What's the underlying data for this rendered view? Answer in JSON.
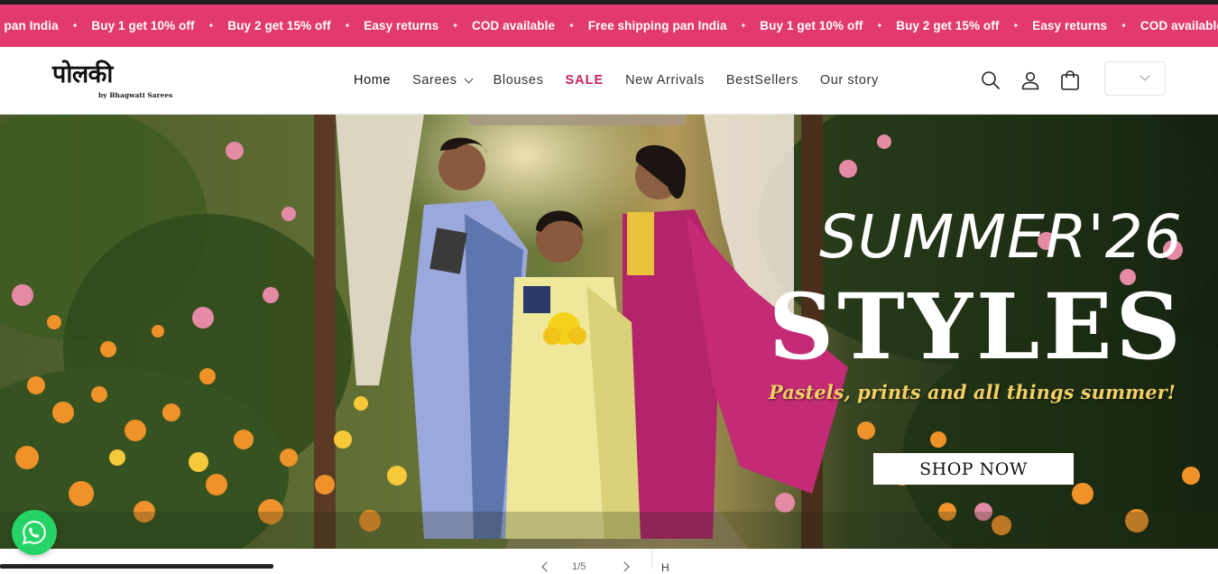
{
  "announcement": {
    "items": [
      "ng pan India",
      "Buy 1 get 10% off",
      "Buy 2 get 15% off",
      "Easy returns",
      "COD available",
      "Free shipping pan India",
      "Buy 1 get 10% off",
      "Buy 2 get 15% off",
      "Easy returns",
      "COD available"
    ],
    "separator": "✦",
    "background": "#e23a6e"
  },
  "brand": {
    "logo_text": "पोलकी",
    "logo_subtext": "by Bhagwati Sarees"
  },
  "nav": {
    "home": "Home",
    "sarees": "Sarees",
    "blouses": "Blouses",
    "sale": "SALE",
    "new_arrivals": "New Arrivals",
    "bestsellers": "BestSellers",
    "our_story": "Our story",
    "sale_color": "#c4245c"
  },
  "header_icons": [
    "search-icon",
    "account-icon",
    "cart-icon"
  ],
  "hero": {
    "title_line1": "SUMMER'26",
    "title_line2": "STYLES",
    "tagline": "Pastels, prints and all things summer!",
    "cta": "SHOP NOW",
    "tagline_color": "#f2cf63"
  },
  "slideshow": {
    "counter": "1/5",
    "next_heading": "H"
  },
  "floating": {
    "whatsapp_icon": "whatsapp-icon",
    "whatsapp_color": "#25d366"
  }
}
